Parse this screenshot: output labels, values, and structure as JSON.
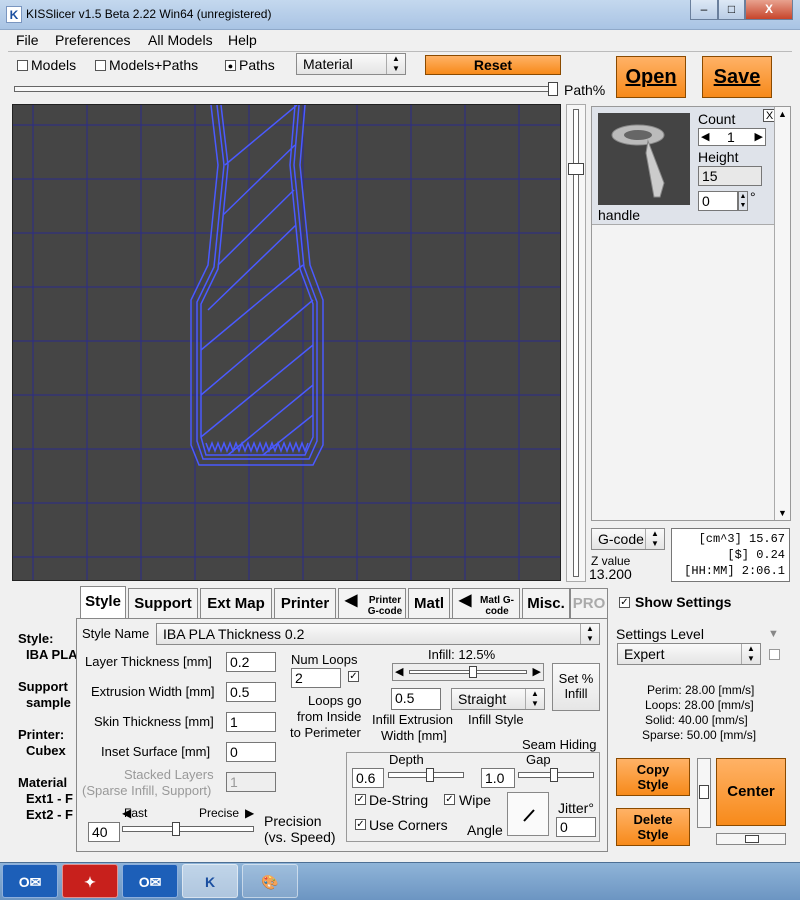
{
  "window": {
    "title": "KISSlicer v1.5 Beta 2.22 Win64 (unregistered)",
    "min_glyph": "–",
    "max_glyph": "□",
    "close_glyph": "X"
  },
  "menu": [
    "File",
    "Preferences",
    "All Models",
    "Help"
  ],
  "toolbar": {
    "models": "Models",
    "models_paths": "Models+Paths",
    "paths": "Paths",
    "color_mode": "Material",
    "reset": "Reset",
    "open": "Open",
    "save": "Save",
    "path_pct": "Path%"
  },
  "model": {
    "count_label": "Count",
    "count": "1",
    "height_label": "Height",
    "height": "15",
    "rotation": "0",
    "degree": "°",
    "name": "handle",
    "close": "X"
  },
  "stats": {
    "gcode_mode": "G-code",
    "z_label": "Z value",
    "z_value": "13.200",
    "volume": "[cm^3] 15.67",
    "cost": "[$] 0.24",
    "time": "[HH:MM] 2:06.1"
  },
  "tabs": [
    "Style",
    "Support",
    "Ext Map",
    "Printer",
    "Printer G-code",
    "Matl",
    "Matl G-code",
    "Misc.",
    "PRO"
  ],
  "left_summary": {
    "style_label": "Style:",
    "style_value": "IBA PLA",
    "support_label": "Support",
    "support_value": "sample",
    "printer_label": "Printer:",
    "printer_value": "Cubex",
    "material_label": "Material",
    "ext1": "Ext1 - F",
    "ext2": "Ext2 - F"
  },
  "style": {
    "style_name_label": "Style Name",
    "style_name": "IBA PLA Thickness 0.2",
    "layer_thickness_label": "Layer Thickness [mm]",
    "layer_thickness": "0.2",
    "extrusion_width_label": "Extrusion Width [mm]",
    "extrusion_width": "0.5",
    "skin_thickness_label": "Skin Thickness [mm]",
    "skin_thickness": "1",
    "inset_label": "Inset Surface [mm]",
    "inset": "0",
    "stacked_label_1": "Stacked Layers",
    "stacked_label_2": "(Sparse Infill, Support)",
    "stacked": "1",
    "num_loops_label": "Num Loops",
    "num_loops": "2",
    "loops_go_1": "Loops go",
    "loops_go_2": "from Inside",
    "loops_go_3": "to Perimeter",
    "infill_label": "Infill: 12.5%",
    "infill_pct": 12.5,
    "set_infill_1": "Set %",
    "set_infill_2": "Infill",
    "infill_width": "0.5",
    "infill_width_label_1": "Infill Extrusion",
    "infill_width_label_2": "Width [mm]",
    "infill_style": "Straight",
    "infill_style_label": "Infill Style",
    "fast": "Fast",
    "precise": "Precise",
    "precision_value": "40",
    "precision_label_1": "Precision",
    "precision_label_2": "(vs. Speed)",
    "seam_label": "Seam Hiding",
    "depth_label": "Depth",
    "depth": "0.6",
    "gap_label": "Gap",
    "gap": "1.0",
    "destring": "De-String",
    "wipe": "Wipe",
    "use_corners": "Use Corners",
    "angle_label": "Angle",
    "jitter_label": "Jitter°",
    "jitter": "0"
  },
  "settings": {
    "show_settings": "Show Settings",
    "level_label": "Settings Level",
    "level": "Expert",
    "perim": "Perim: 28.00 [mm/s]",
    "loops": "Loops: 28.00 [mm/s]",
    "solid": "Solid: 40.00 [mm/s]",
    "sparse": "Sparse: 50.00 [mm/s]",
    "copy_style_1": "Copy",
    "copy_style_2": "Style",
    "delete_style_1": "Delete",
    "delete_style_2": "Style",
    "center": "Center"
  },
  "colors": {
    "accent_orange": "#f78a1a",
    "viewport_bg": "#454545",
    "grid": "#2b2b8a",
    "path_blue": "#4a5aff"
  }
}
